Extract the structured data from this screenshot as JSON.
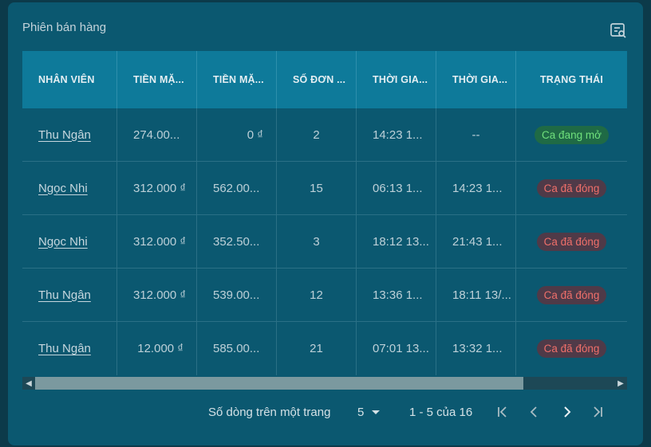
{
  "card": {
    "title": "Phiên bán hàng",
    "icon": "filter-list-icon"
  },
  "table": {
    "headers": [
      "NHÂN VIÊN",
      "TIỀN MẶ...",
      "TIỀN MẶ...",
      "SỐ ĐƠN ...",
      "THỜI GIA...",
      "THỜI GIA...",
      "TRẠNG THÁI"
    ],
    "rows": [
      {
        "staff": "Thu Ngân",
        "cash_open": "274.00...",
        "cash_close": "0 ₫",
        "orders": "2",
        "time_open": "14:23 1...",
        "time_close": "--",
        "status": "Ca đang mở",
        "status_type": "open"
      },
      {
        "staff": "Ngọc Nhi",
        "cash_open": "312.000 ₫",
        "cash_close": "562.00...",
        "orders": "15",
        "time_open": "06:13 1...",
        "time_close": "14:23 1...",
        "status": "Ca đã đóng",
        "status_type": "closed"
      },
      {
        "staff": "Ngọc Nhi",
        "cash_open": "312.000 ₫",
        "cash_close": "352.50...",
        "orders": "3",
        "time_open": "18:12 13...",
        "time_close": "21:43 1...",
        "status": "Ca đã đóng",
        "status_type": "closed"
      },
      {
        "staff": "Thu Ngân",
        "cash_open": "312.000 ₫",
        "cash_close": "539.00...",
        "orders": "12",
        "time_open": "13:36 1...",
        "time_close": "18:11 13/...",
        "status": "Ca đã đóng",
        "status_type": "closed"
      },
      {
        "staff": "Thu Ngân",
        "cash_open": "12.000 ₫",
        "cash_close": "585.00...",
        "orders": "21",
        "time_open": "07:01 13...",
        "time_close": "13:32 1...",
        "status": "Ca đã đóng",
        "status_type": "closed"
      }
    ]
  },
  "pagination": {
    "rows_per_page_label": "Số dòng trên một trang",
    "rows_per_page_value": "5",
    "range_label": "1 - 5 của 16"
  },
  "colors": {
    "open_badge_text": "#6fe07c",
    "closed_badge_text": "#ef6f6a",
    "header_bg": "#0e7a9a",
    "card_bg": "#0b5870"
  }
}
